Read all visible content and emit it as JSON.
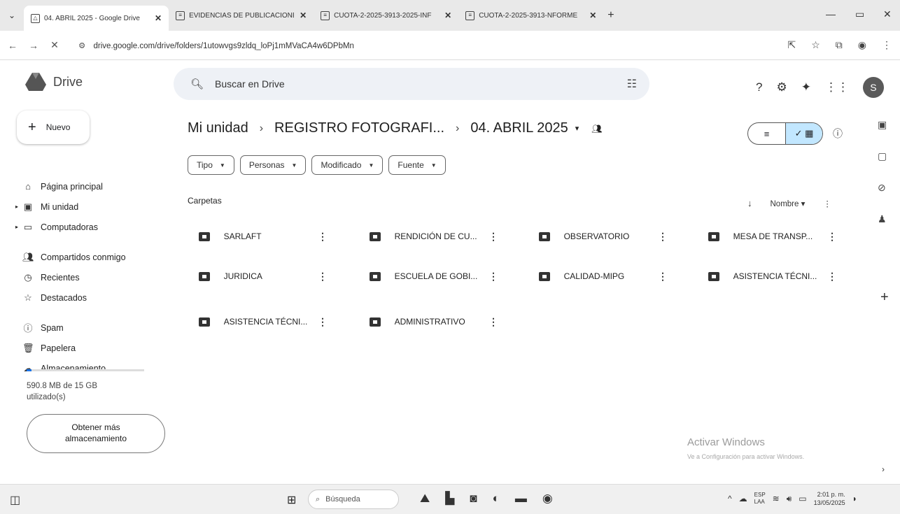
{
  "browser": {
    "tabs": [
      {
        "title": "04. ABRIL 2025 - Google Drive",
        "active": true
      },
      {
        "title": "EVIDENCIAS DE PUBLICACIONE",
        "active": false
      },
      {
        "title": "CUOTA-2-2025-3913-2025-INF",
        "active": false
      },
      {
        "title": "CUOTA-2-2025-3913-NFORME",
        "active": false
      }
    ],
    "url": "drive.google.com/drive/folders/1utowvgs9zldq_loPj1mMVaCA4w6DPbMn"
  },
  "drive": {
    "app_name": "Drive",
    "search_placeholder": "Buscar en Drive",
    "avatar_letter": "S",
    "new_label": "Nuevo"
  },
  "sidebar": {
    "items": [
      {
        "label": "Página principal",
        "icon": "home-icon"
      },
      {
        "label": "Mi unidad",
        "icon": "my-drive-icon"
      },
      {
        "label": "Computadoras",
        "icon": "computer-icon"
      },
      {
        "label": "Compartidos conmigo",
        "icon": "people-icon"
      },
      {
        "label": "Recientes",
        "icon": "clock-icon"
      },
      {
        "label": "Destacados",
        "icon": "star-icon"
      },
      {
        "label": "Spam",
        "icon": "spam-icon"
      },
      {
        "label": "Papelera",
        "icon": "trash-icon"
      },
      {
        "label": "Almacenamiento",
        "icon": "cloud-icon"
      }
    ],
    "storage_used_fraction": 0.04,
    "storage_line1": "590.8 MB de 15 GB",
    "storage_line2": "utilizado(s)",
    "more_storage_line1": "Obtener más",
    "more_storage_line2": "almacenamiento"
  },
  "breadcrumb": {
    "root": "Mi unidad",
    "middle": "REGISTRO FOTOGRAFI...",
    "current": "04. ABRIL 2025"
  },
  "filters": [
    "Tipo",
    "Personas",
    "Modificado",
    "Fuente"
  ],
  "content": {
    "section_title": "Carpetas",
    "sort_label": "Nombre",
    "folders": [
      "SARLAFT",
      "RENDICIÓN DE CU...",
      "OBSERVATORIO",
      "MESA DE TRANSP...",
      "JURIDICA",
      "ESCUELA DE GOBI...",
      "CALIDAD-MIPG",
      "ASISTENCIA TÉCNI...",
      "ASISTENCIA TÉCNI...",
      "ADMINISTRATIVO"
    ]
  },
  "watermark": {
    "line1": "Activar Windows",
    "line2": "Ve a Configuración para activar Windows."
  },
  "taskbar": {
    "search_label": "Búsqueda",
    "lang_top": "ESP",
    "lang_bottom": "LAA",
    "time": "2:01 p. m.",
    "date": "13/05/2025"
  }
}
